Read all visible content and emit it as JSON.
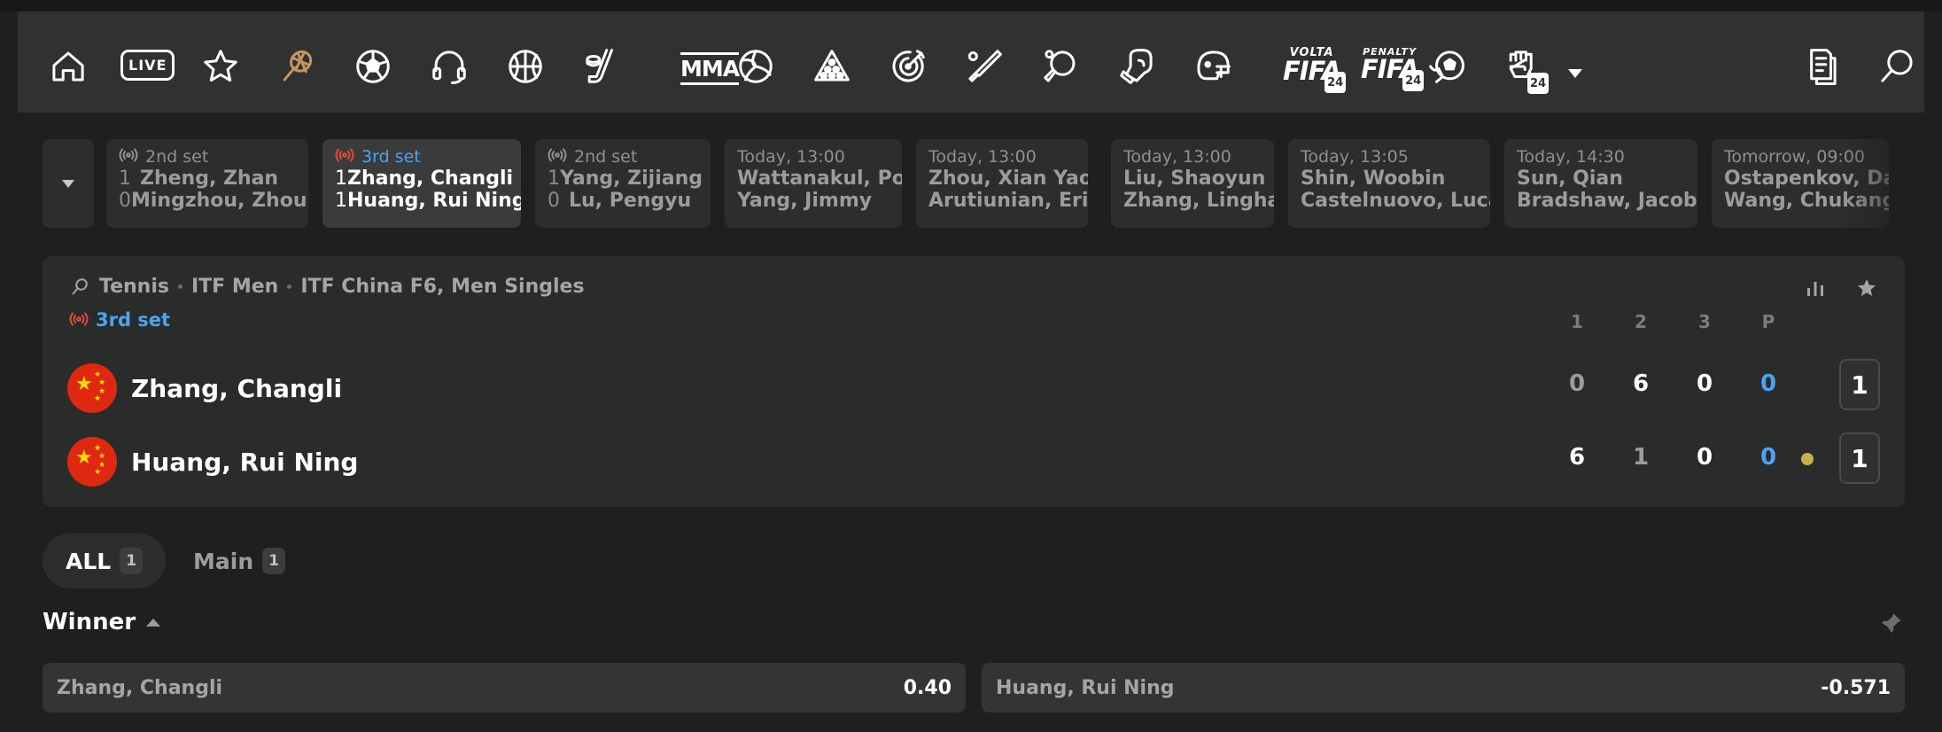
{
  "nav": {
    "live_label": "LIVE",
    "mma_label": "MMA",
    "volta_small": "VOLTA",
    "volta_big": "FIFA",
    "penalty_small": "PENALTY",
    "penalty_big": "FIFA",
    "badge_24": "24",
    "active_sport": "tennis",
    "icons": [
      "home-icon",
      "live-icon",
      "star-icon",
      "tennis-icon",
      "soccer-icon",
      "esports-headset-icon",
      "basketball-icon",
      "hockey-icon",
      "mma-icon",
      "volleyball-icon",
      "snooker-icon",
      "darts-icon",
      "baseball-icon",
      "table-tennis-icon",
      "boxing-icon",
      "american-football-icon",
      "volta-fifa-icon",
      "penalty-fifa-icon",
      "esoccer-icon",
      "fist-icon",
      "more-chevron-icon",
      "betslip-icon",
      "search-icon"
    ]
  },
  "strip": {
    "matches": [
      {
        "status": "2nd set",
        "live": true,
        "selected": false,
        "home_score": "1",
        "home": "Zheng, Zhan",
        "away_score": "0",
        "away": "Mingzhou, Zhou"
      },
      {
        "status": "3rd set",
        "live": true,
        "selected": true,
        "home_score": "1",
        "home": "Zhang, Changli",
        "away_score": "1",
        "away": "Huang, Rui Ning"
      },
      {
        "status": "2nd set",
        "live": true,
        "selected": false,
        "home_score": "1",
        "home": "Yang, Zijiang",
        "away_score": "0",
        "away": "Lu, Pengyu"
      },
      {
        "status": "Today, 13:00",
        "live": false,
        "selected": false,
        "home": "Wattanakul, Pol",
        "away": "Yang, Jimmy"
      },
      {
        "status": "Today, 13:00",
        "live": false,
        "selected": false,
        "home": "Zhou, Xian Yao",
        "away": "Arutiunian, Erik"
      },
      {
        "status": "Today, 13:00",
        "live": false,
        "selected": false,
        "home": "Liu, Shaoyun",
        "away": "Zhang, Linghao"
      },
      {
        "status": "Today, 13:05",
        "live": false,
        "selected": false,
        "home": "Shin, Woobin",
        "away": "Castelnuovo, Luca"
      },
      {
        "status": "Today, 14:30",
        "live": false,
        "selected": false,
        "home": "Sun, Qian",
        "away": "Bradshaw, Jacob"
      },
      {
        "status": "Tomorrow, 09:00",
        "live": false,
        "selected": false,
        "home": "Ostapenkov, Danil",
        "away": "Wang, Chukang"
      }
    ]
  },
  "event": {
    "breadcrumb": [
      "Tennis",
      "ITF Men",
      "ITF China F6, Men Singles"
    ],
    "status": "3rd set",
    "set_headers": [
      "1",
      "2",
      "3",
      "P"
    ],
    "players": [
      {
        "name": "Zhang, Changli",
        "sets": [
          "0",
          "6",
          "0"
        ],
        "points": "0",
        "total": "1",
        "serving": false
      },
      {
        "name": "Huang, Rui Ning",
        "sets": [
          "6",
          "1",
          "0"
        ],
        "points": "0",
        "total": "1",
        "serving": true
      }
    ]
  },
  "tabs": [
    {
      "label": "ALL",
      "count": "1",
      "active": true
    },
    {
      "label": "Main",
      "count": "1",
      "active": false
    }
  ],
  "market": {
    "title": "Winner",
    "outcomes": [
      {
        "name": "Zhang, Changli",
        "odds": "0.40"
      },
      {
        "name": "Huang, Rui Ning",
        "odds": "-0.571"
      }
    ]
  },
  "colors": {
    "accent_blue": "#4ba3f2",
    "live_red": "#e24a3b",
    "tennis_active": "#c8955e",
    "serve_dot": "#c8b04a"
  }
}
